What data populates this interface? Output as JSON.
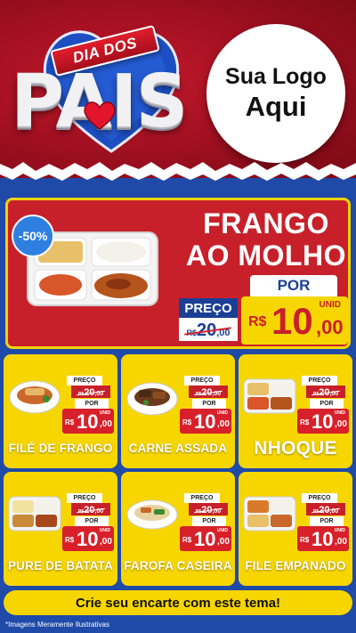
{
  "header": {
    "ribbon_text": "DIA DOS",
    "title": "PAIS",
    "logo_line1": "Sua Logo",
    "logo_line2": "Aqui"
  },
  "featured": {
    "discount": "-50%",
    "title_line1": "FRANGO",
    "title_line2": "AO MOLHO",
    "por_label": "POR",
    "preco_label": "PREÇO",
    "old_price": {
      "currency": "R$",
      "integer": "20",
      "decimal": ",00"
    },
    "new_price": {
      "unid": "UNID",
      "currency": "R$",
      "integer": "10",
      "decimal": ",00"
    }
  },
  "cards": [
    {
      "name": "FILÉ DE FRANGO",
      "preco_label": "PREÇO",
      "por_label": "POR",
      "old_currency": "R$",
      "old_integer": "20",
      "old_decimal": ",00",
      "unid": "UNID",
      "new_currency": "R$",
      "new_integer": "10",
      "new_decimal": ",00"
    },
    {
      "name": "CARNE ASSADA",
      "preco_label": "PREÇO",
      "por_label": "POR",
      "old_currency": "R$",
      "old_integer": "20",
      "old_decimal": ",00",
      "unid": "UNID",
      "new_currency": "R$",
      "new_integer": "10",
      "new_decimal": ",00"
    },
    {
      "name": "NHOQUE",
      "preco_label": "PREÇO",
      "por_label": "POR",
      "old_currency": "R$",
      "old_integer": "20",
      "old_decimal": ",00",
      "unid": "UNID",
      "new_currency": "R$",
      "new_integer": "10",
      "new_decimal": ",00"
    },
    {
      "name": "PURE DE BATATA",
      "preco_label": "PREÇO",
      "por_label": "POR",
      "old_currency": "R$",
      "old_integer": "20",
      "old_decimal": ",00",
      "unid": "UNID",
      "new_currency": "R$",
      "new_integer": "10",
      "new_decimal": ",00"
    },
    {
      "name": "FAROFA CASEIRA",
      "preco_label": "PREÇO",
      "por_label": "POR",
      "old_currency": "R$",
      "old_integer": "20",
      "old_decimal": ",00",
      "unid": "UNID",
      "new_currency": "R$",
      "new_integer": "10",
      "new_decimal": ",00"
    },
    {
      "name": "FILE EMPANADO",
      "preco_label": "PREÇO",
      "por_label": "POR",
      "old_currency": "R$",
      "old_integer": "20",
      "old_decimal": ",00",
      "unid": "UNID",
      "new_currency": "R$",
      "new_integer": "10",
      "new_decimal": ",00"
    }
  ],
  "cta": "Crie seu encarte com este tema!",
  "disclaimer": "*Imagens Meramente Ilustrativas",
  "colors": {
    "header_red": "#9d0f1f",
    "background_blue": "#1f4aa8",
    "card_yellow": "#f7d600",
    "price_red": "#d8202a",
    "navy": "#1b3f94",
    "discount_blue": "#2f7fe0"
  },
  "icons": [
    "heart-icon",
    "food-tray-image",
    "food-bowl-image",
    "food-plate-image"
  ]
}
